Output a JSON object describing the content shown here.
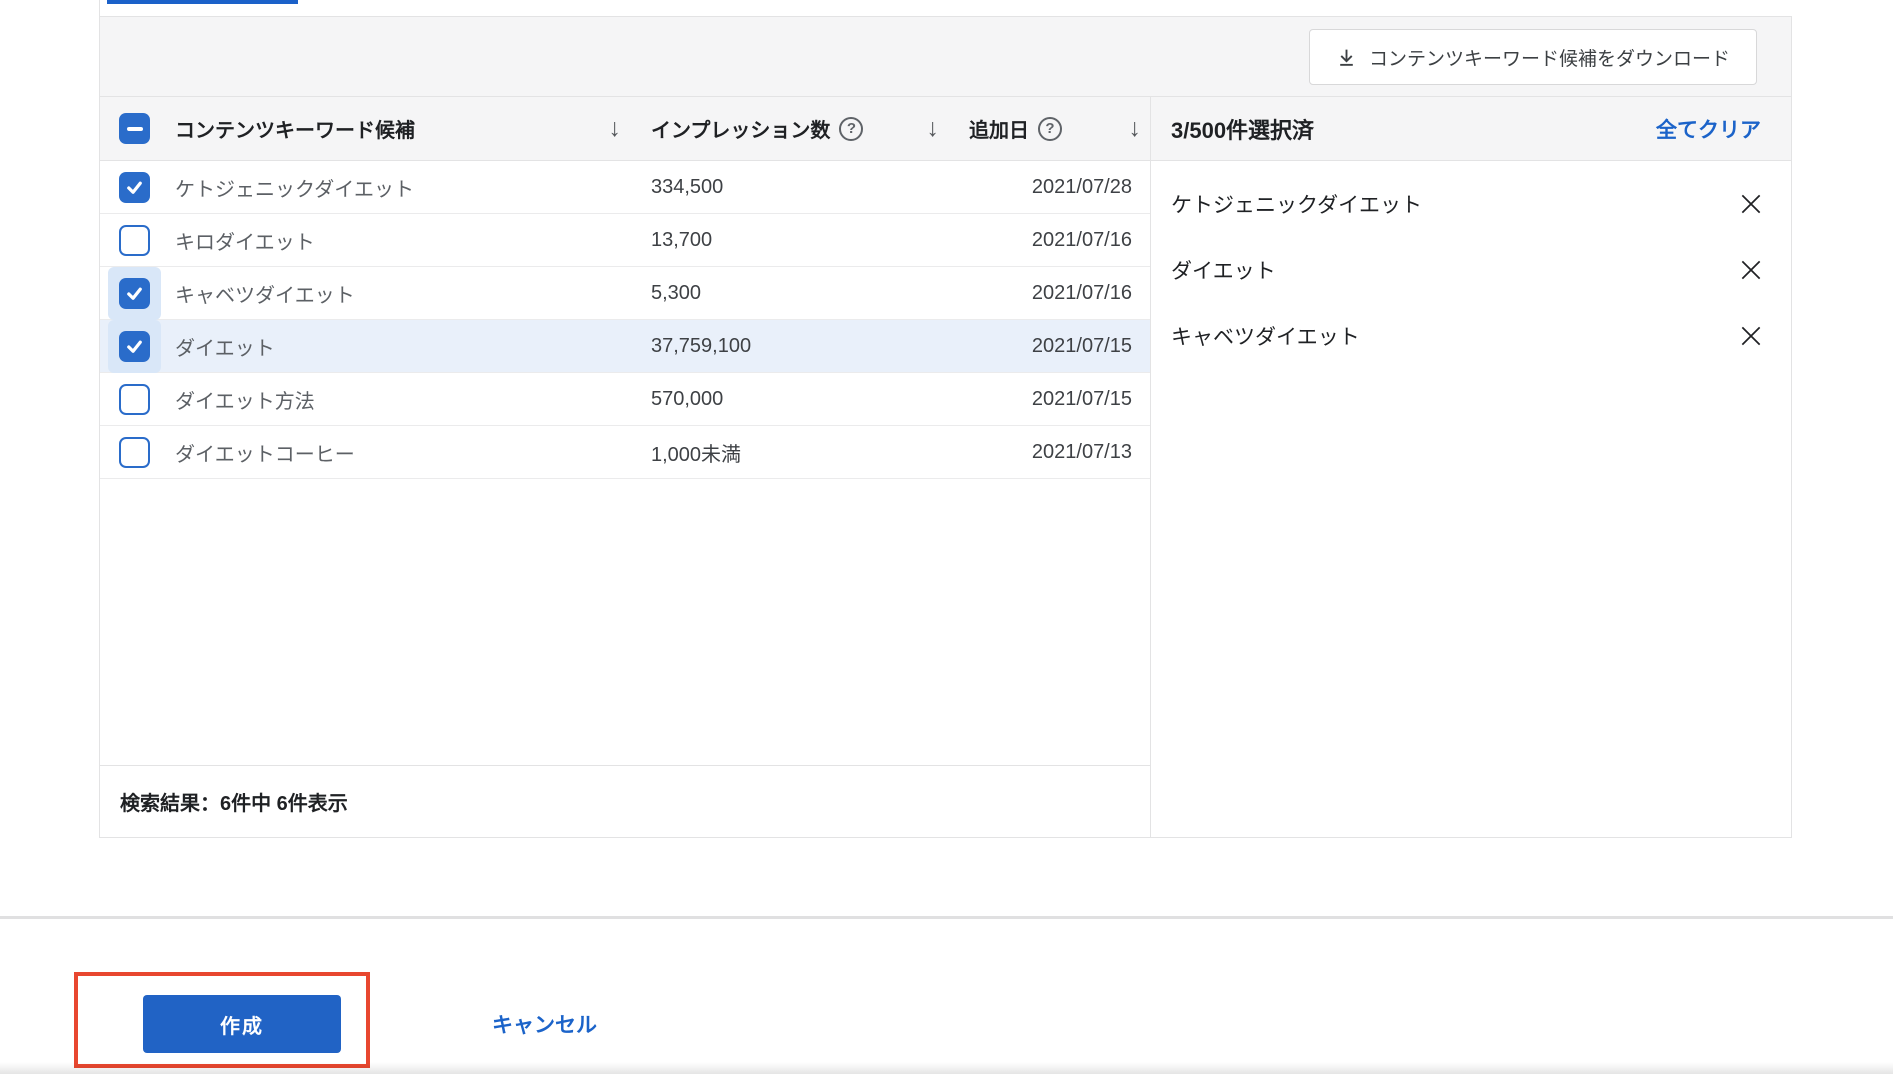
{
  "tab": {
    "active_underline": true
  },
  "toolbar": {
    "download_button": {
      "label": "コンテンツキーワード候補をダウンロード",
      "icon": "download-icon"
    }
  },
  "table": {
    "select_all_state": "indeterminate",
    "columns": [
      {
        "id": "keyword",
        "label": "コンテンツキーワード候補",
        "sortable": true,
        "sort_icon": "sort-desc-icon"
      },
      {
        "id": "impressions",
        "label": "インプレッション数",
        "help_icon": "help-icon",
        "sortable": true,
        "sort_icon": "sort-desc-icon"
      },
      {
        "id": "added_date",
        "label": "追加日",
        "help_icon": "help-icon",
        "sortable": true,
        "sort_icon": "sort-desc-icon"
      }
    ],
    "rows": [
      {
        "keyword": "ケトジェニックダイエット",
        "impressions": "334,500",
        "added": "2021/07/28",
        "checked": true,
        "focused": false,
        "highlighted": false
      },
      {
        "keyword": "キロダイエット",
        "impressions": "13,700",
        "added": "2021/07/16",
        "checked": false,
        "focused": false,
        "highlighted": false
      },
      {
        "keyword": "キャベツダイエット",
        "impressions": "5,300",
        "added": "2021/07/16",
        "checked": true,
        "focused": true,
        "highlighted": false
      },
      {
        "keyword": "ダイエット",
        "impressions": "37,759,100",
        "added": "2021/07/15",
        "checked": true,
        "focused": true,
        "highlighted": true
      },
      {
        "keyword": "ダイエット方法",
        "impressions": "570,000",
        "added": "2021/07/15",
        "checked": false,
        "focused": false,
        "highlighted": false
      },
      {
        "keyword": "ダイエットコーヒー",
        "impressions": "1,000未満",
        "added": "2021/07/13",
        "checked": false,
        "focused": false,
        "highlighted": false
      }
    ],
    "footer": {
      "results_text": "検索結果：6件中 6件表示"
    }
  },
  "selection_panel": {
    "count_text": "3/500件選択済",
    "clear_all_label": "全てクリア",
    "selected_items": [
      {
        "label": "ケトジェニックダイエット",
        "remove_icon": "close-icon"
      },
      {
        "label": "ダイエット",
        "remove_icon": "close-icon"
      },
      {
        "label": "キャベツダイエット",
        "remove_icon": "close-icon"
      }
    ]
  },
  "actions": {
    "create_label": "作成",
    "cancel_label": "キャンセル",
    "create_highlight": "red-annotation-rectangle"
  },
  "colors": {
    "accent_button": "#2163c5",
    "checkbox_blue": "#2a6cca",
    "link_blue": "#1b63c9",
    "tab_underline": "#1b61c9",
    "row_highlight": "#e9f0fa",
    "checkbox_halo": "#d9e7f8",
    "band_gray": "#f5f5f6",
    "border_gray": "#e3e3e4",
    "annotation_red": "#e8472f"
  }
}
